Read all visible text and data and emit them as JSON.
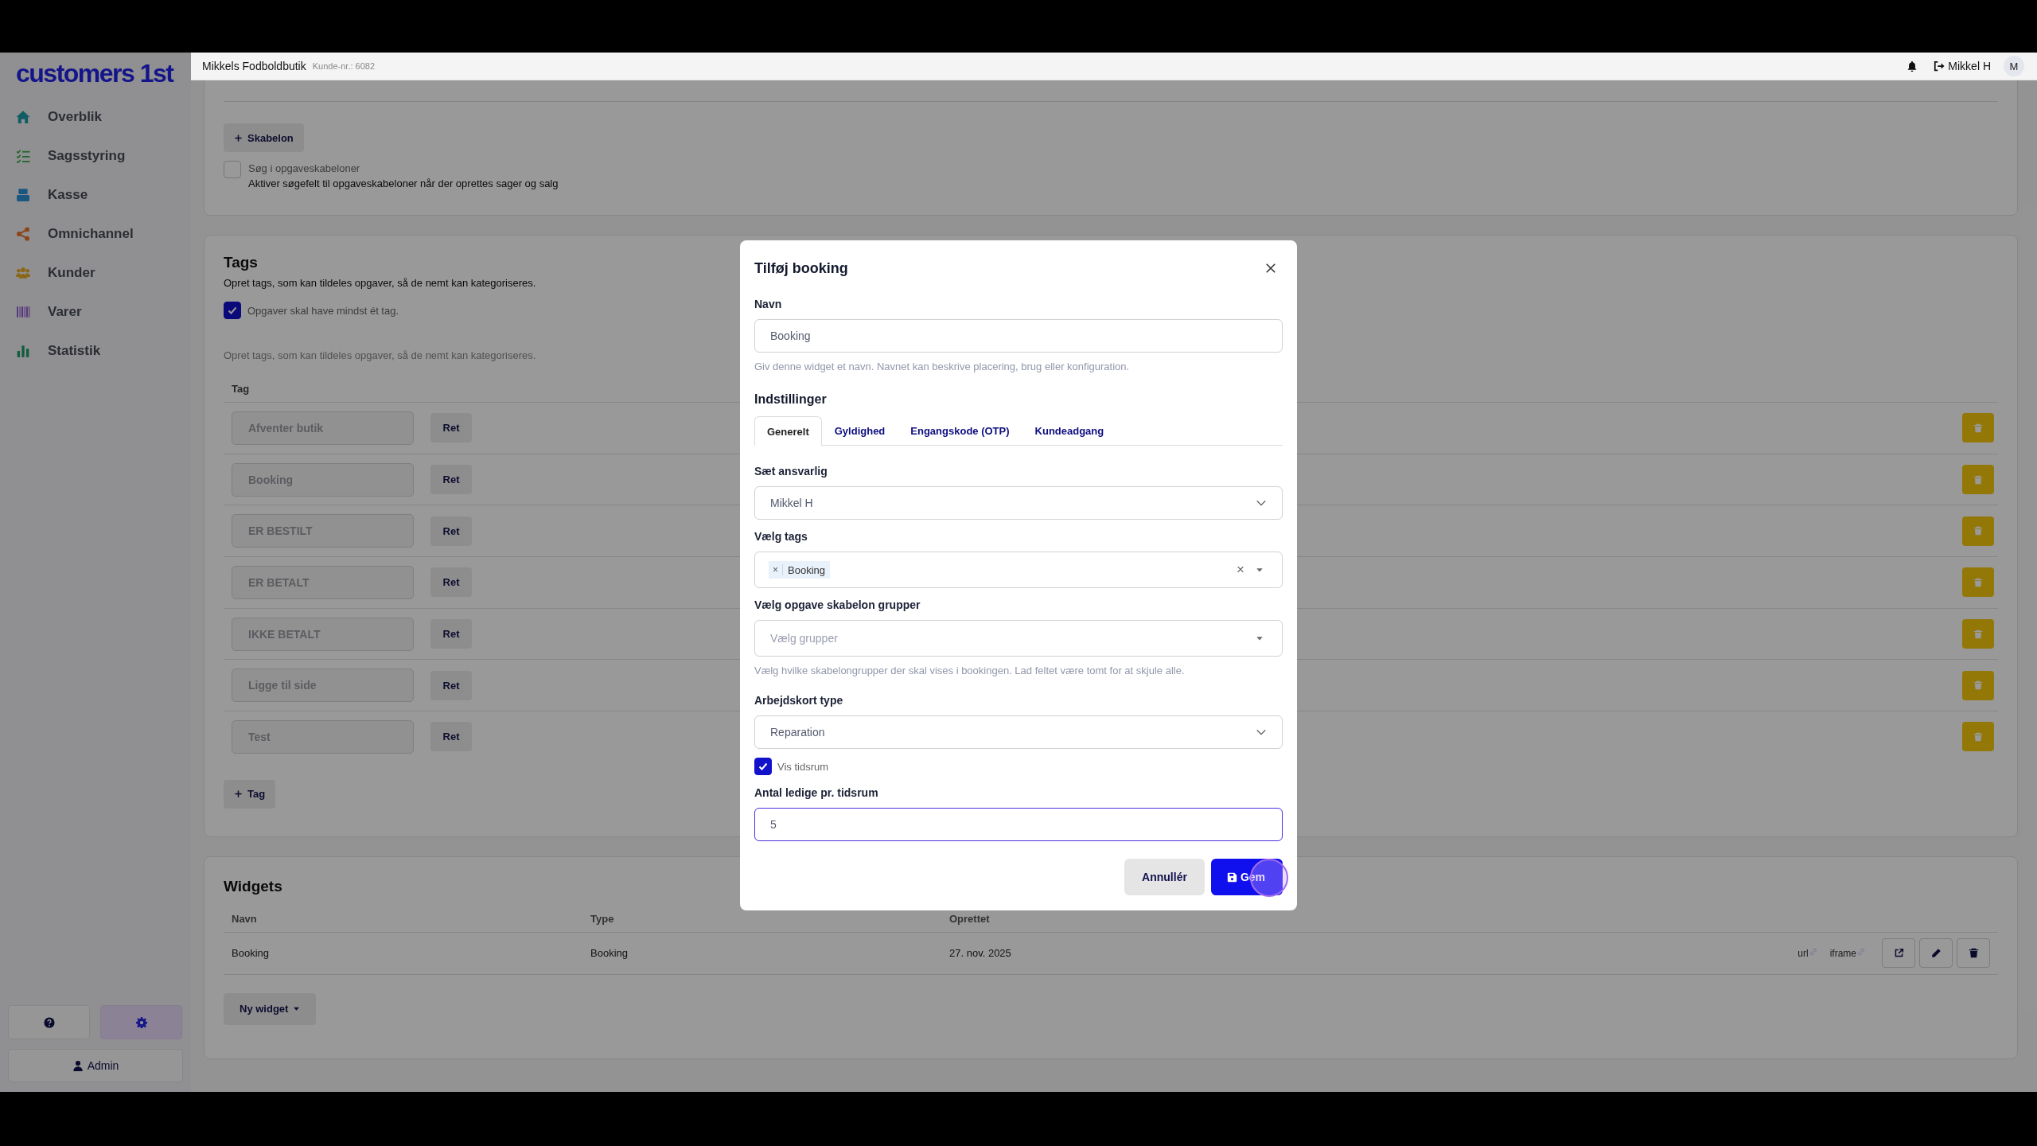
{
  "header": {
    "logo": "customers 1st",
    "shop_name": "Mikkels Fodboldbutik",
    "customer_number": "Kunde-nr.: 6082",
    "user_name": "Mikkel H",
    "avatar": "M"
  },
  "sidebar": {
    "items": [
      {
        "label": "Overblik",
        "color": "#125c64"
      },
      {
        "label": "Sagsstyring",
        "color": "#23652c"
      },
      {
        "label": "Kasse",
        "color": "#195680"
      },
      {
        "label": "Omnichannel",
        "color": "#8b4519"
      },
      {
        "label": "Kunder",
        "color": "#8b6513"
      },
      {
        "label": "Varer",
        "color": "#53307d"
      },
      {
        "label": "Statistik",
        "color": "#135c40"
      }
    ],
    "admin_button": "Admin"
  },
  "templates_section": {
    "add_button": "Skabelon",
    "search_option": {
      "label": "Søg i opgaveskabeloner",
      "description": "Aktiver søgefelt til opgaveskabeloner når der oprettes sager og salg",
      "checked": false
    }
  },
  "tags_section": {
    "title": "Tags",
    "description": "Opret tags, som kan tildeles opgaver, så de nemt kan kategoriseres.",
    "require_tag": {
      "label": "Opgaver skal have mindst ét tag.",
      "checked": true
    },
    "hint": "Opret tags, som kan tildeles opgaver, så de nemt kan kategoriseres.",
    "column": "Tag",
    "rows": [
      {
        "name": "Afventer butik",
        "edit_button": "Ret"
      },
      {
        "name": "Booking",
        "edit_button": "Ret"
      },
      {
        "name": "ER BESTILT",
        "edit_button": "Ret"
      },
      {
        "name": "ER BETALT",
        "edit_button": "Ret"
      },
      {
        "name": "IKKE BETALT",
        "edit_button": "Ret"
      },
      {
        "name": "Ligge til side",
        "edit_button": "Ret"
      },
      {
        "name": "Test",
        "edit_button": "Ret"
      }
    ],
    "add_button": "Tag"
  },
  "widgets_section": {
    "title": "Widgets",
    "columns": [
      "Navn",
      "Type",
      "Oprettet"
    ],
    "rows": [
      {
        "name": "Booking",
        "type": "Booking",
        "created": "27. nov. 2025",
        "url_link": "url",
        "iframe_link": "iframe"
      }
    ],
    "new_button": "Ny widget"
  },
  "modal": {
    "title": "Tilføj booking",
    "name_field": {
      "label": "Navn",
      "value": "Booking",
      "hint": "Giv denne widget et navn. Navnet kan beskrive placering, brug eller konfiguration."
    },
    "settings_title": "Indstillinger",
    "tabs": [
      {
        "label": "Generelt",
        "selected": true
      },
      {
        "label": "Gyldighed",
        "selected": false
      },
      {
        "label": "Engangskode (OTP)",
        "selected": false
      },
      {
        "label": "Kundeadgang",
        "selected": false
      }
    ],
    "responsible": {
      "label": "Sæt ansvarlig",
      "value": "Mikkel H"
    },
    "tags": {
      "label": "Vælg tags",
      "chips": [
        {
          "label": "Booking",
          "remove": "×"
        }
      ],
      "clear": "×"
    },
    "template_groups": {
      "label": "Vælg opgave skabelon grupper",
      "placeholder": "Vælg grupper",
      "hint": "Vælg hvilke skabelongrupper der skal vises i bookingen. Lad feltet være tomt for at skjule alle."
    },
    "card_type": {
      "label": "Arbejdskort type",
      "value": "Reparation"
    },
    "show_timeslots": {
      "label": "Vis tidsrum",
      "checked": true
    },
    "slots": {
      "label": "Antal ledige pr. tidsrum",
      "value": "5",
      "focused": true
    },
    "cancel_button": "Annullér",
    "save_button": "Gem"
  }
}
